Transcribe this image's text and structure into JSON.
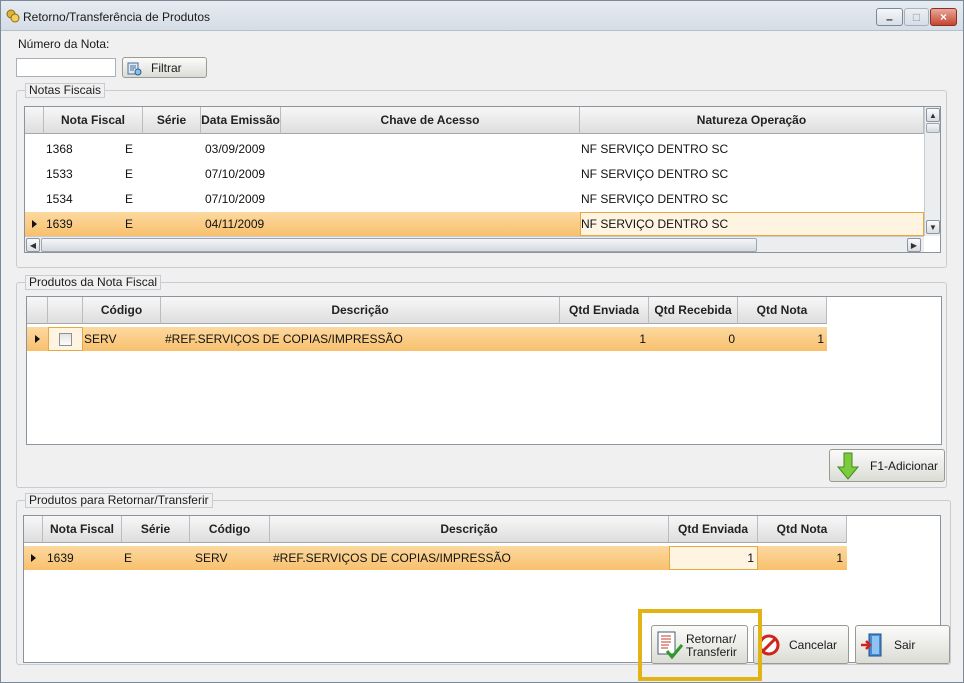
{
  "window": {
    "title": "Retorno/Transferência de Produtos",
    "minimize": "–",
    "maximize": "□",
    "close": "×"
  },
  "filter": {
    "label": "Número da Nota:",
    "value": "",
    "button_label": "Filtrar"
  },
  "notas": {
    "group_title": "Notas Fiscais",
    "columns": [
      "Nota Fiscal",
      "Série",
      "Data Emissão",
      "Chave de Acesso",
      "Natureza Operação"
    ],
    "rows": [
      [
        "1368",
        "E",
        "03/09/2009",
        "",
        "NF SERVIÇO DENTRO SC"
      ],
      [
        "1533",
        "E",
        "07/10/2009",
        "",
        "NF SERVIÇO DENTRO SC"
      ],
      [
        "1534",
        "E",
        "07/10/2009",
        "",
        "NF SERVIÇO DENTRO SC"
      ],
      [
        "1639",
        "E",
        "04/11/2009",
        "",
        "NF SERVIÇO DENTRO SC"
      ]
    ]
  },
  "produtos": {
    "group_title": "Produtos da Nota Fiscal",
    "columns": [
      "",
      "Código",
      "Descrição",
      "Qtd Enviada",
      "Qtd Recebida",
      "Qtd Nota"
    ],
    "rows": [
      [
        "",
        "SERV",
        "#REF.SERVIÇOS DE COPIAS/IMPRESSÃO",
        "1",
        "0",
        "1"
      ]
    ],
    "add_button": "F1-Adicionar"
  },
  "retornar": {
    "group_title": "Produtos para Retornar/Transferir",
    "columns": [
      "Nota Fiscal",
      "Série",
      "Código",
      "Descrição",
      "Qtd Enviada",
      "Qtd Nota"
    ],
    "rows": [
      [
        "1639",
        "E",
        "SERV",
        "#REF.SERVIÇOS DE COPIAS/IMPRESSÃO",
        "1",
        "1"
      ]
    ]
  },
  "actions": {
    "retornar_line1": "Retornar/",
    "retornar_line2": "Transferir",
    "cancelar": "Cancelar",
    "sair": "Sair"
  },
  "icons": [
    "app-icon",
    "filter-icon",
    "down-arrow-icon",
    "document-check-icon",
    "no-entry-icon",
    "exit-door-icon"
  ],
  "colors": {
    "selection": "#f8c06d",
    "highlight_frame": "#e2b315"
  }
}
